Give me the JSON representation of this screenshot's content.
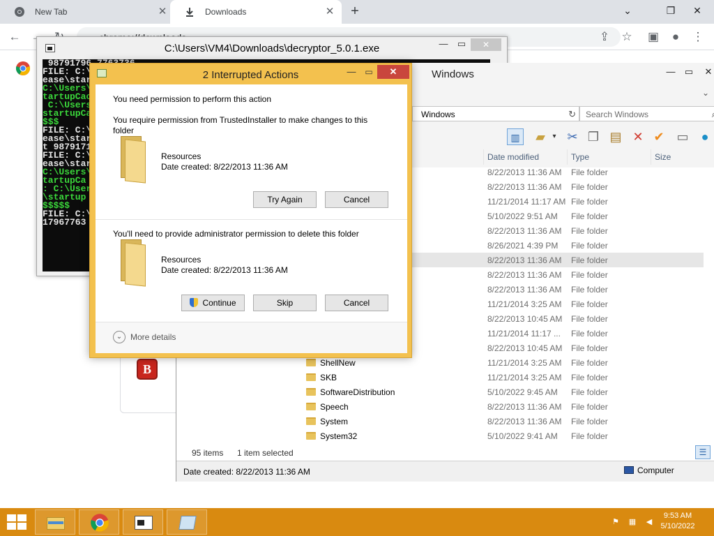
{
  "chrome": {
    "tabs": [
      {
        "label": "New Tab",
        "icon": "chrome-icon"
      },
      {
        "label": "Downloads",
        "icon": "download-icon"
      }
    ],
    "address": "chrome://downloads",
    "address_scheme": "Chrome"
  },
  "console": {
    "title": "C:\\Users\\VM4\\Downloads\\decryptor_5.0.1.exe",
    "lines": [
      {
        "text": " 98791796 7763736",
        "color": "white"
      },
      {
        "text": "FILE: C:\\",
        "color": "white"
      },
      {
        "text": "ease\\start",
        "color": "white"
      },
      {
        "text": "C:\\Users\\",
        "color": "green"
      },
      {
        "text": "tartupCac",
        "color": "green"
      },
      {
        "text": "",
        "color": "white"
      },
      {
        "text": " C:\\Users\\",
        "color": "green"
      },
      {
        "text": "startupCa",
        "color": "green"
      },
      {
        "text": "$$$",
        "color": "green"
      },
      {
        "text": "FILE: C:\\",
        "color": "white"
      },
      {
        "text": "ease\\star",
        "color": "white"
      },
      {
        "text": "t 9879171",
        "color": "white"
      },
      {
        "text": "FILE: C:\\",
        "color": "white"
      },
      {
        "text": "ease\\star",
        "color": "white"
      },
      {
        "text": "C:\\Users\\",
        "color": "green"
      },
      {
        "text": "tartupCa",
        "color": "green"
      },
      {
        "text": "",
        "color": "white"
      },
      {
        "text": ": C:\\User",
        "color": "green"
      },
      {
        "text": "\\startup",
        "color": "green"
      },
      {
        "text": "$$$$$",
        "color": "green"
      },
      {
        "text": "FILE: C:\\",
        "color": "white"
      },
      {
        "text": "17967763",
        "color": "white"
      }
    ]
  },
  "explorer": {
    "title": "Windows",
    "address": "Windows",
    "search_placeholder": "Search Windows",
    "columns": [
      "Date modified",
      "Type",
      "Size"
    ],
    "rows": [
      {
        "name": "",
        "date": "8/22/2013 11:36 AM",
        "type": "File folder"
      },
      {
        "name": "",
        "date": "8/22/2013 11:36 AM",
        "type": "File folder"
      },
      {
        "name": "",
        "date": "11/21/2014 11:17 AM",
        "type": "File folder"
      },
      {
        "name": "",
        "date": "5/10/2022 9:51 AM",
        "type": "File folder"
      },
      {
        "name": "",
        "date": "8/22/2013 11:36 AM",
        "type": "File folder"
      },
      {
        "name": "",
        "date": "8/26/2021 4:39 PM",
        "type": "File folder"
      },
      {
        "name": "",
        "date": "8/22/2013 11:36 AM",
        "type": "File folder",
        "selected": true
      },
      {
        "name": "",
        "date": "8/22/2013 11:36 AM",
        "type": "File folder"
      },
      {
        "name": "",
        "date": "8/22/2013 11:36 AM",
        "type": "File folder"
      },
      {
        "name": "",
        "date": "11/21/2014 3:25 AM",
        "type": "File folder"
      },
      {
        "name": "",
        "date": "8/22/2013 10:45 AM",
        "type": "File folder"
      },
      {
        "name": "",
        "date": "11/21/2014 11:17 ...",
        "type": "File folder"
      },
      {
        "name": "",
        "date": "8/22/2013 10:45 AM",
        "type": "File folder"
      },
      {
        "name": "ShellNew",
        "date": "11/21/2014 3:25 AM",
        "type": "File folder"
      },
      {
        "name": "SKB",
        "date": "11/21/2014 3:25 AM",
        "type": "File folder"
      },
      {
        "name": "SoftwareDistribution",
        "date": "5/10/2022 9:45 AM",
        "type": "File folder"
      },
      {
        "name": "Speech",
        "date": "8/22/2013 11:36 AM",
        "type": "File folder"
      },
      {
        "name": "System",
        "date": "8/22/2013 11:36 AM",
        "type": "File folder"
      },
      {
        "name": "System32",
        "date": "5/10/2022 9:41 AM",
        "type": "File folder"
      }
    ],
    "status_items": "95 items",
    "status_selected": "1 item selected",
    "details_text": "Date created: 8/22/2013 11:36 AM",
    "computer_label": "Computer"
  },
  "dialog": {
    "title": "2 Interrupted Actions",
    "section1": {
      "heading": "You need permission to perform this action",
      "text": "You require permission from TrustedInstaller to make changes to this folder",
      "item_name": "Resources",
      "item_date": "Date created: 8/22/2013 11:36 AM",
      "btn_try": "Try Again",
      "btn_cancel": "Cancel"
    },
    "section2": {
      "text": "You'll need to provide administrator permission to delete this folder",
      "item_name": "Resources",
      "item_date": "Date created: 8/22/2013 11:36 AM",
      "btn_continue": "Continue",
      "btn_skip": "Skip",
      "btn_cancel": "Cancel"
    },
    "more_details": "More details"
  },
  "taskbar": {
    "time": "9:53 AM",
    "date": "5/10/2022",
    "color": "#d98a10"
  }
}
